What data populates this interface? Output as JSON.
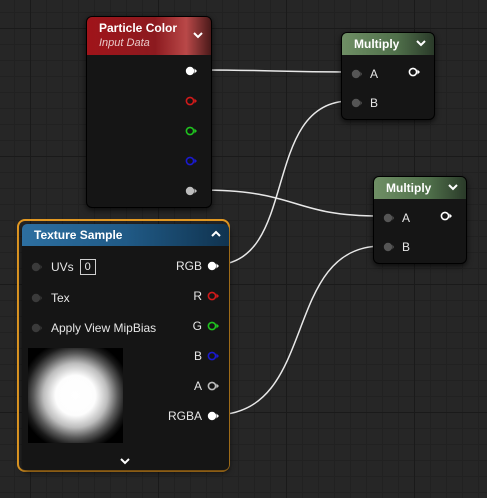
{
  "nodes": {
    "particle_color": {
      "title": "Particle Color",
      "subtitle": "Input Data",
      "outputs": [
        {
          "color": "#ffffff"
        },
        {
          "color": "#d11a1a"
        },
        {
          "color": "#1fc31f"
        },
        {
          "color": "#1a1ad0"
        },
        {
          "color": "#bdbdbd"
        }
      ]
    },
    "multiply_1": {
      "title": "Multiply",
      "input_a": "A",
      "input_b": "B"
    },
    "multiply_2": {
      "title": "Multiply",
      "input_a": "A",
      "input_b": "B"
    },
    "texture_sample": {
      "title": "Texture Sample",
      "inputs": {
        "uvs": "UVs",
        "uvs_value": "0",
        "tex": "Tex",
        "apply_view_mipbias": "Apply View MipBias"
      },
      "outputs": {
        "rgb": "RGB",
        "r": "R",
        "g": "G",
        "b": "B",
        "a": "A",
        "rgba": "RGBA"
      }
    }
  },
  "icons": [
    "chevron-down-icon",
    "chevron-up-icon",
    "output-pin-icon",
    "input-pin-icon"
  ],
  "colors": {
    "particle_header": "#a0141a",
    "multiply_header": "#6f8f65",
    "texture_header": "#2d6fa0",
    "selection_outline": "#e49a23",
    "wire": "#e8e8e8"
  }
}
